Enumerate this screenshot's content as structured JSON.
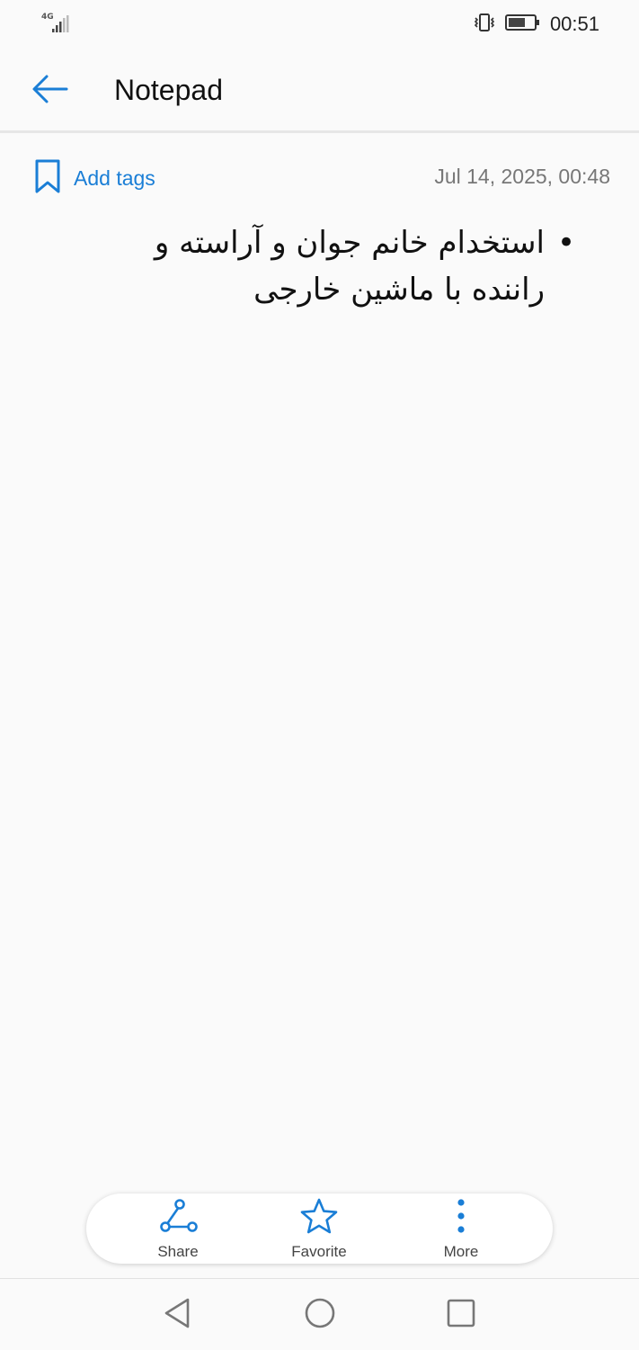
{
  "status_bar": {
    "network_label": "4G",
    "time": "00:51"
  },
  "header": {
    "title": "Notepad",
    "back_icon": "arrow-left-icon"
  },
  "meta": {
    "add_tags_label": "Add tags",
    "tag_icon": "bookmark-icon",
    "timestamp": "Jul 14, 2025, 00:48"
  },
  "note": {
    "bullet_text": "استخدام خانم جوان و آراسته و راننده با ماشین خارجی"
  },
  "actions": {
    "share_label": "Share",
    "favorite_label": "Favorite",
    "more_label": "More"
  },
  "colors": {
    "accent": "#1a7ed6",
    "background": "#fafafa"
  }
}
